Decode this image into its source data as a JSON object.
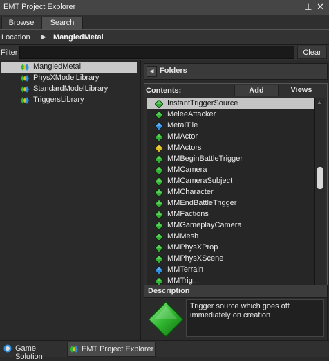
{
  "window": {
    "title": "EMT Project Explorer"
  },
  "tabs": [
    {
      "label": "Browse"
    },
    {
      "label": "Search"
    }
  ],
  "location": {
    "label": "Location",
    "path": "MangledMetal"
  },
  "filter": {
    "label": "Filter",
    "value": "",
    "clear_label": "Clear"
  },
  "tree": {
    "items": [
      {
        "label": "MangledMetal",
        "icon": "project-icon",
        "selected": true
      },
      {
        "label": "PhysXModelLibrary",
        "icon": "library-icon"
      },
      {
        "label": "StandardModelLibrary",
        "icon": "library-icon"
      },
      {
        "label": "TriggersLibrary",
        "icon": "library-icon"
      }
    ]
  },
  "folders": {
    "label": "Folders"
  },
  "contents": {
    "label": "Contents:",
    "add_label": "Add",
    "views_label": "Views",
    "items": [
      {
        "label": "InstantTriggerSource",
        "icon": "green-diamond-icon",
        "selected": true
      },
      {
        "label": "MeleeAttacker",
        "icon": "green-diamond-icon"
      },
      {
        "label": "MetalTile",
        "icon": "blue-diamond-icon"
      },
      {
        "label": "MMActor",
        "icon": "green-diamond-icon"
      },
      {
        "label": "MMActors",
        "icon": "yellow-diamond-icon"
      },
      {
        "label": "MMBeginBattleTrigger",
        "icon": "green-diamond-icon"
      },
      {
        "label": "MMCamera",
        "icon": "green-diamond-icon"
      },
      {
        "label": "MMCameraSubject",
        "icon": "green-diamond-icon"
      },
      {
        "label": "MMCharacter",
        "icon": "green-diamond-icon"
      },
      {
        "label": "MMEndBattleTrigger",
        "icon": "green-diamond-icon"
      },
      {
        "label": "MMFactions",
        "icon": "green-diamond-icon"
      },
      {
        "label": "MMGameplayCamera",
        "icon": "green-diamond-icon"
      },
      {
        "label": "MMMesh",
        "icon": "green-diamond-icon"
      },
      {
        "label": "MMPhysXProp",
        "icon": "green-diamond-icon"
      },
      {
        "label": "MMPhysXScene",
        "icon": "green-diamond-icon"
      },
      {
        "label": "MMTerrain",
        "icon": "blue-diamond-icon"
      },
      {
        "label": "MMTrig...",
        "icon": "green-diamond-icon"
      }
    ]
  },
  "description": {
    "label": "Description",
    "text": "Trigger source which goes off immediately on creation",
    "icon": "green-diamond-icon"
  },
  "bottom_tabs": [
    {
      "label": "Game Solution",
      "icon": "solution-icon"
    },
    {
      "label": "EMT Project Explorer",
      "icon": "explorer-icon"
    }
  ],
  "colors": {
    "green": "#2fb52f",
    "blue": "#2e8fe0",
    "yellow": "#e0c020",
    "selection": "#c9c9c9"
  }
}
